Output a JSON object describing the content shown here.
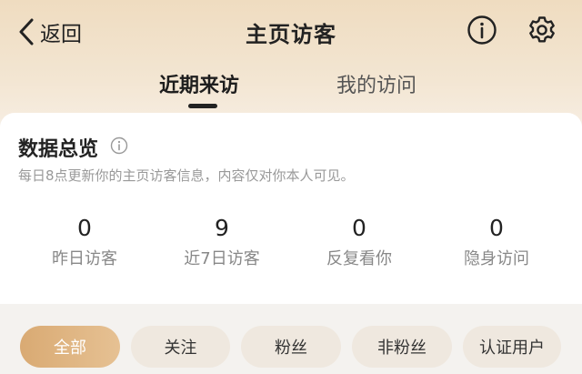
{
  "header": {
    "back_label": "返回",
    "title": "主页访客"
  },
  "tabs": [
    {
      "label": "近期来访",
      "active": true
    },
    {
      "label": "我的访问",
      "active": false
    }
  ],
  "overview": {
    "title": "数据总览",
    "description": "每日8点更新你的主页访客信息，内容仅对你本人可见。",
    "stats": [
      {
        "value": "0",
        "label": "昨日访客"
      },
      {
        "value": "9",
        "label": "近7日访客"
      },
      {
        "value": "0",
        "label": "反复看你"
      },
      {
        "value": "0",
        "label": "隐身访问"
      }
    ]
  },
  "filters": [
    {
      "label": "全部",
      "active": true
    },
    {
      "label": "关注",
      "active": false
    },
    {
      "label": "粉丝",
      "active": false
    },
    {
      "label": "非粉丝",
      "active": false
    },
    {
      "label": "认证用户",
      "active": false
    }
  ],
  "colors": {
    "accent": "#d9aa73",
    "header_bg": "#efdcc0",
    "chip_bg": "#efe8df"
  },
  "icons": [
    "chevron-left-icon",
    "info-icon",
    "gear-icon"
  ]
}
